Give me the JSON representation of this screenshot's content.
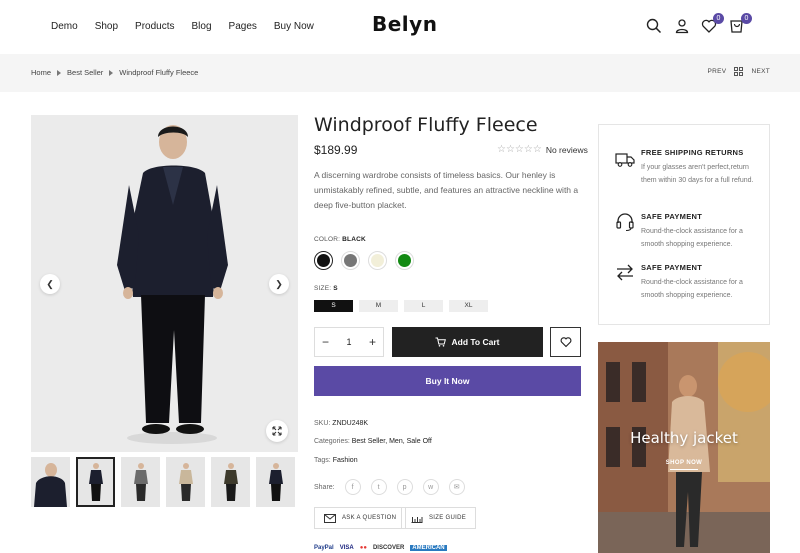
{
  "nav": {
    "items": [
      "Demo",
      "Shop",
      "Products",
      "Blog",
      "Pages",
      "Buy Now"
    ],
    "logo": "Belyn",
    "wishlist_count": "0",
    "cart_count": "0"
  },
  "breadcrumb": {
    "items": [
      "Home",
      "Best Seller",
      "Windproof Fluffy Fleece"
    ],
    "prev": "PREV",
    "next": "NEXT"
  },
  "product": {
    "title": "Windproof Fluffy Fleece",
    "price": "$189.99",
    "rating": 0,
    "reviews_text": "No reviews",
    "description": "A discerning wardrobe consists of timeless basics. Our henley is unmistakably refined, subtle, and features an attractive neckline with a deep five-button placket.",
    "color_label": "COLOR:",
    "color_value": "BLACK",
    "colors": [
      "#111111",
      "#777777",
      "#f2efd9",
      "#138a13"
    ],
    "size_label": "SIZE:",
    "size_value": "S",
    "sizes": [
      "S",
      "M",
      "L",
      "XL"
    ],
    "quantity": "1",
    "add_to_cart": "Add To Cart",
    "buy_now": "Buy It Now",
    "sku_label": "SKU:",
    "sku": "ZNDU248K",
    "categories_label": "Categories:",
    "categories": "Best Seller, Men, Sale Off",
    "tags_label": "Tags:",
    "tags": "Fashion",
    "share_label": "Share:",
    "ask_question": "ASK A QUESTION",
    "size_guide": "SIZE GUIDE",
    "payments": [
      "PayPal",
      "VISA",
      "DISCOVER",
      "AMERICAN"
    ]
  },
  "features": [
    {
      "icon": "truck-icon",
      "title": "FREE SHIPPING RETURNS",
      "text": "If your glasses aren't perfect,return them within 30 days for a full refund."
    },
    {
      "icon": "headset-icon",
      "title": "SAFE PAYMENT",
      "text": "Round-the-clock assistance for a smooth shopping experience."
    },
    {
      "icon": "exchange-icon",
      "title": "SAFE PAYMENT",
      "text": "Round-the-clock assistance for a smooth shopping experience."
    }
  ],
  "banner": {
    "title": "Healthy jacket",
    "cta": "SHOP NOW"
  },
  "colors": {
    "accent": "#5a4aa5",
    "dark": "#222222"
  }
}
